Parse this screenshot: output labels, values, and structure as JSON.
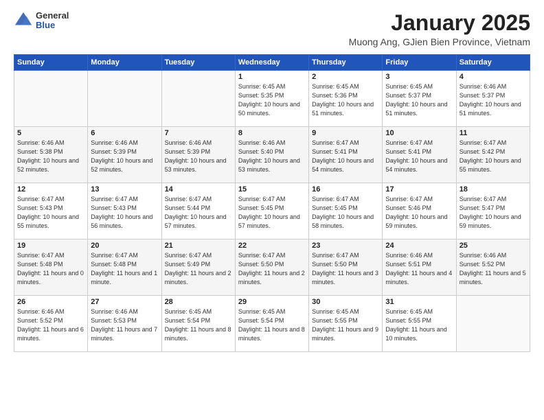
{
  "header": {
    "logo": {
      "general": "General",
      "blue": "Blue"
    },
    "title": "January 2025",
    "subtitle": "Muong Ang, GJien Bien Province, Vietnam"
  },
  "calendar": {
    "days_of_week": [
      "Sunday",
      "Monday",
      "Tuesday",
      "Wednesday",
      "Thursday",
      "Friday",
      "Saturday"
    ],
    "weeks": [
      [
        {
          "day": "",
          "sunrise": "",
          "sunset": "",
          "daylight": ""
        },
        {
          "day": "",
          "sunrise": "",
          "sunset": "",
          "daylight": ""
        },
        {
          "day": "",
          "sunrise": "",
          "sunset": "",
          "daylight": ""
        },
        {
          "day": "1",
          "sunrise": "Sunrise: 6:45 AM",
          "sunset": "Sunset: 5:35 PM",
          "daylight": "Daylight: 10 hours and 50 minutes."
        },
        {
          "day": "2",
          "sunrise": "Sunrise: 6:45 AM",
          "sunset": "Sunset: 5:36 PM",
          "daylight": "Daylight: 10 hours and 51 minutes."
        },
        {
          "day": "3",
          "sunrise": "Sunrise: 6:45 AM",
          "sunset": "Sunset: 5:37 PM",
          "daylight": "Daylight: 10 hours and 51 minutes."
        },
        {
          "day": "4",
          "sunrise": "Sunrise: 6:46 AM",
          "sunset": "Sunset: 5:37 PM",
          "daylight": "Daylight: 10 hours and 51 minutes."
        }
      ],
      [
        {
          "day": "5",
          "sunrise": "Sunrise: 6:46 AM",
          "sunset": "Sunset: 5:38 PM",
          "daylight": "Daylight: 10 hours and 52 minutes."
        },
        {
          "day": "6",
          "sunrise": "Sunrise: 6:46 AM",
          "sunset": "Sunset: 5:39 PM",
          "daylight": "Daylight: 10 hours and 52 minutes."
        },
        {
          "day": "7",
          "sunrise": "Sunrise: 6:46 AM",
          "sunset": "Sunset: 5:39 PM",
          "daylight": "Daylight: 10 hours and 53 minutes."
        },
        {
          "day": "8",
          "sunrise": "Sunrise: 6:46 AM",
          "sunset": "Sunset: 5:40 PM",
          "daylight": "Daylight: 10 hours and 53 minutes."
        },
        {
          "day": "9",
          "sunrise": "Sunrise: 6:47 AM",
          "sunset": "Sunset: 5:41 PM",
          "daylight": "Daylight: 10 hours and 54 minutes."
        },
        {
          "day": "10",
          "sunrise": "Sunrise: 6:47 AM",
          "sunset": "Sunset: 5:41 PM",
          "daylight": "Daylight: 10 hours and 54 minutes."
        },
        {
          "day": "11",
          "sunrise": "Sunrise: 6:47 AM",
          "sunset": "Sunset: 5:42 PM",
          "daylight": "Daylight: 10 hours and 55 minutes."
        }
      ],
      [
        {
          "day": "12",
          "sunrise": "Sunrise: 6:47 AM",
          "sunset": "Sunset: 5:43 PM",
          "daylight": "Daylight: 10 hours and 55 minutes."
        },
        {
          "day": "13",
          "sunrise": "Sunrise: 6:47 AM",
          "sunset": "Sunset: 5:43 PM",
          "daylight": "Daylight: 10 hours and 56 minutes."
        },
        {
          "day": "14",
          "sunrise": "Sunrise: 6:47 AM",
          "sunset": "Sunset: 5:44 PM",
          "daylight": "Daylight: 10 hours and 57 minutes."
        },
        {
          "day": "15",
          "sunrise": "Sunrise: 6:47 AM",
          "sunset": "Sunset: 5:45 PM",
          "daylight": "Daylight: 10 hours and 57 minutes."
        },
        {
          "day": "16",
          "sunrise": "Sunrise: 6:47 AM",
          "sunset": "Sunset: 5:45 PM",
          "daylight": "Daylight: 10 hours and 58 minutes."
        },
        {
          "day": "17",
          "sunrise": "Sunrise: 6:47 AM",
          "sunset": "Sunset: 5:46 PM",
          "daylight": "Daylight: 10 hours and 59 minutes."
        },
        {
          "day": "18",
          "sunrise": "Sunrise: 6:47 AM",
          "sunset": "Sunset: 5:47 PM",
          "daylight": "Daylight: 10 hours and 59 minutes."
        }
      ],
      [
        {
          "day": "19",
          "sunrise": "Sunrise: 6:47 AM",
          "sunset": "Sunset: 5:48 PM",
          "daylight": "Daylight: 11 hours and 0 minutes."
        },
        {
          "day": "20",
          "sunrise": "Sunrise: 6:47 AM",
          "sunset": "Sunset: 5:48 PM",
          "daylight": "Daylight: 11 hours and 1 minute."
        },
        {
          "day": "21",
          "sunrise": "Sunrise: 6:47 AM",
          "sunset": "Sunset: 5:49 PM",
          "daylight": "Daylight: 11 hours and 2 minutes."
        },
        {
          "day": "22",
          "sunrise": "Sunrise: 6:47 AM",
          "sunset": "Sunset: 5:50 PM",
          "daylight": "Daylight: 11 hours and 2 minutes."
        },
        {
          "day": "23",
          "sunrise": "Sunrise: 6:47 AM",
          "sunset": "Sunset: 5:50 PM",
          "daylight": "Daylight: 11 hours and 3 minutes."
        },
        {
          "day": "24",
          "sunrise": "Sunrise: 6:46 AM",
          "sunset": "Sunset: 5:51 PM",
          "daylight": "Daylight: 11 hours and 4 minutes."
        },
        {
          "day": "25",
          "sunrise": "Sunrise: 6:46 AM",
          "sunset": "Sunset: 5:52 PM",
          "daylight": "Daylight: 11 hours and 5 minutes."
        }
      ],
      [
        {
          "day": "26",
          "sunrise": "Sunrise: 6:46 AM",
          "sunset": "Sunset: 5:52 PM",
          "daylight": "Daylight: 11 hours and 6 minutes."
        },
        {
          "day": "27",
          "sunrise": "Sunrise: 6:46 AM",
          "sunset": "Sunset: 5:53 PM",
          "daylight": "Daylight: 11 hours and 7 minutes."
        },
        {
          "day": "28",
          "sunrise": "Sunrise: 6:45 AM",
          "sunset": "Sunset: 5:54 PM",
          "daylight": "Daylight: 11 hours and 8 minutes."
        },
        {
          "day": "29",
          "sunrise": "Sunrise: 6:45 AM",
          "sunset": "Sunset: 5:54 PM",
          "daylight": "Daylight: 11 hours and 8 minutes."
        },
        {
          "day": "30",
          "sunrise": "Sunrise: 6:45 AM",
          "sunset": "Sunset: 5:55 PM",
          "daylight": "Daylight: 11 hours and 9 minutes."
        },
        {
          "day": "31",
          "sunrise": "Sunrise: 6:45 AM",
          "sunset": "Sunset: 5:55 PM",
          "daylight": "Daylight: 11 hours and 10 minutes."
        },
        {
          "day": "",
          "sunrise": "",
          "sunset": "",
          "daylight": ""
        }
      ]
    ]
  }
}
